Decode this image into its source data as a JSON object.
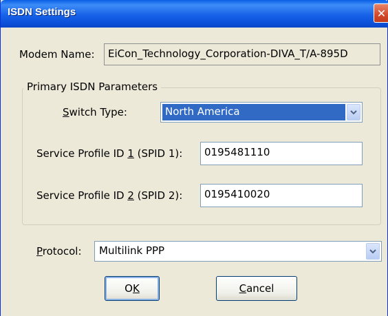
{
  "window": {
    "title": "ISDN Settings",
    "close_icon": "close-icon"
  },
  "modem": {
    "label": "Modem Name:",
    "value": "EiCon_Technology_Corporation-DIVA_T/A-895D"
  },
  "primary_group": {
    "legend": "Primary ISDN Parameters",
    "switch_type": {
      "label_pre": "",
      "label_ul": "S",
      "label_post": "witch Type:",
      "value": "North America"
    },
    "spid1": {
      "label_pre": "Service Profile ID ",
      "label_ul": "1",
      "label_post": " (SPID 1):",
      "value": "0195481110"
    },
    "spid2": {
      "label_pre": "Service Profile ID ",
      "label_ul": "2",
      "label_post": " (SPID 2):",
      "value": "0195410020"
    }
  },
  "protocol": {
    "label_ul": "P",
    "label_post": "rotocol:",
    "value": "Multilink PPP"
  },
  "buttons": {
    "ok": {
      "pre": "O",
      "ul": "K",
      "post": ""
    },
    "cancel": {
      "pre": "",
      "ul": "C",
      "post": "ancel"
    }
  },
  "colors": {
    "titlebar": "#0a5fe6",
    "selection": "#316ac5",
    "dialog_bg": "#ece9d8"
  }
}
